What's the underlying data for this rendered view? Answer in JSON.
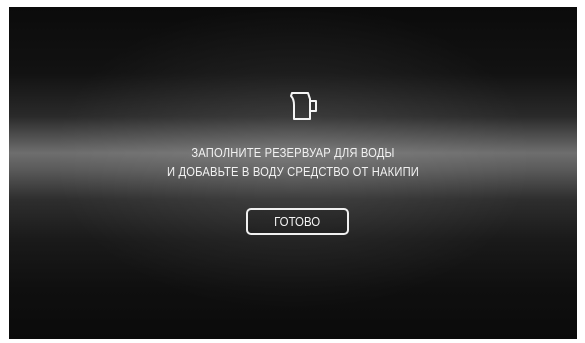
{
  "screen": {
    "icon": "pitcher-icon",
    "message_line_1": "ЗАПОЛНИТЕ РЕЗЕРВУАР ДЛЯ ВОДЫ",
    "message_line_2": "И ДОБАВЬТЕ В ВОДУ СРЕДСТВО ОТ НАКИПИ",
    "done_button_label": "ГОТОВО"
  },
  "colors": {
    "background": "#0b0b0b",
    "highlight_band": "#6e6e6e",
    "text": "#f2f2f2",
    "button_border": "#f0f0f0"
  }
}
